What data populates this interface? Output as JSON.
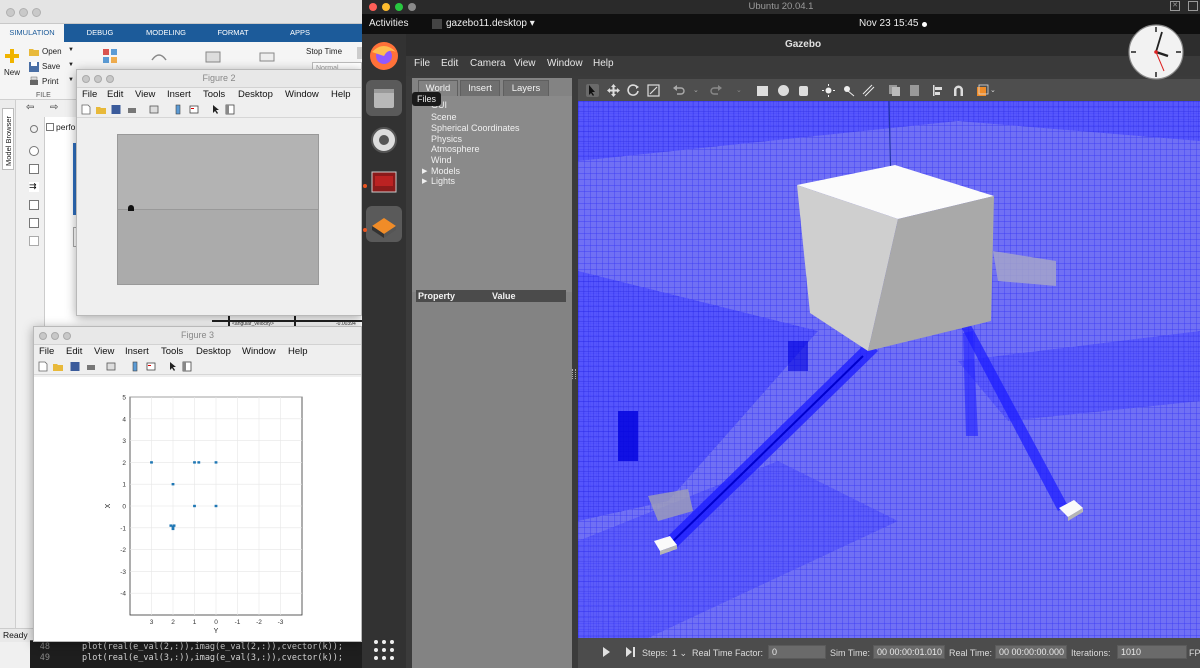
{
  "matlab": {
    "ribbon_tabs": [
      "SIMULATION",
      "DEBUG",
      "MODELING",
      "FORMAT",
      "APPS"
    ],
    "new_label": "New",
    "open_label": "Open",
    "save_label": "Save",
    "print_label": "Print",
    "file_group_label": "FILE",
    "stop_time_label": "Stop Time",
    "stop_time_value": "Normal",
    "model_browser_label": "Model Browser",
    "breadcrumb": "perfo",
    "status": "Ready",
    "code_lines": [
      {
        "num": "48",
        "text": "plot(real(e_val(2,:)),imag(e_val(2,:)),cvector(k));"
      },
      {
        "num": "49",
        "text": "plot(real(e_val(3,:)),imag(e_val(3,:)),cvector(k));"
      }
    ],
    "sim_block_label": "<angular_velocity>",
    "sim_value_label": "-0.00394"
  },
  "figure2": {
    "title": "Figure 2",
    "menu": [
      "File",
      "Edit",
      "View",
      "Insert",
      "Tools",
      "Desktop",
      "Window",
      "Help"
    ]
  },
  "figure3": {
    "title": "Figure 3",
    "menu": [
      "File",
      "Edit",
      "View",
      "Insert",
      "Tools",
      "Desktop",
      "Window",
      "Help"
    ],
    "xlabel": "Y",
    "ylabel": "X"
  },
  "chart_data": {
    "type": "scatter",
    "title": "",
    "xlabel": "Y",
    "ylabel": "X",
    "x_direction": "reversed",
    "xlim": [
      -4,
      4
    ],
    "ylim": [
      -5,
      5
    ],
    "xticks": [
      3,
      2,
      1,
      0,
      -1,
      -2,
      -3
    ],
    "yticks": [
      5,
      4,
      3,
      2,
      1,
      0,
      -1,
      -2,
      -3,
      -4
    ],
    "grid": true,
    "color": "#1f77b4",
    "series": [
      {
        "x": [
          3.0,
          2.0,
          1.0,
          0.8,
          0.0,
          2.0,
          1.0,
          0.0,
          2.1,
          1.95,
          2.0
        ],
        "y": [
          2.0,
          1.0,
          2.0,
          2.0,
          2.0,
          -0.95,
          0.0,
          0.0,
          -0.9,
          -0.9,
          -1.05
        ]
      }
    ]
  },
  "ubuntu": {
    "window_title": "Ubuntu 20.04.1",
    "activities": "Activities",
    "app_indicator": "gazebo11.desktop ▾",
    "datetime": "Nov 23  15:45",
    "files_tooltip": "Files"
  },
  "gazebo": {
    "title": "Gazebo",
    "menu": [
      "File",
      "Edit",
      "Camera",
      "View",
      "Window",
      "Help"
    ],
    "tabs": [
      "World",
      "Insert",
      "Layers"
    ],
    "tree": [
      {
        "label": "GUI",
        "expandable": false
      },
      {
        "label": "Scene",
        "expandable": false
      },
      {
        "label": "Spherical Coordinates",
        "expandable": false
      },
      {
        "label": "Physics",
        "expandable": false
      },
      {
        "label": "Atmosphere",
        "expandable": false
      },
      {
        "label": "Wind",
        "expandable": false
      },
      {
        "label": "Models",
        "expandable": true
      },
      {
        "label": "Lights",
        "expandable": true
      }
    ],
    "property_header": "Property",
    "value_header": "Value",
    "steps_label": "Steps:",
    "steps_value": "1 ⌄",
    "rtf_label": "Real Time Factor:",
    "rtf_value": "0",
    "sim_time_label": "Sim Time:",
    "sim_time_value": "00 00:00:01.010",
    "real_time_label": "Real Time:",
    "real_time_value": "00 00:00:00.000",
    "iterations_label": "Iterations:",
    "iterations_value": "1010",
    "fps_label": "FP"
  },
  "colors": {
    "matlab_blue": "#1c5b9a",
    "gazebo_ray_blue": "#3a3aff",
    "plot_marker": "#1f77b4"
  }
}
